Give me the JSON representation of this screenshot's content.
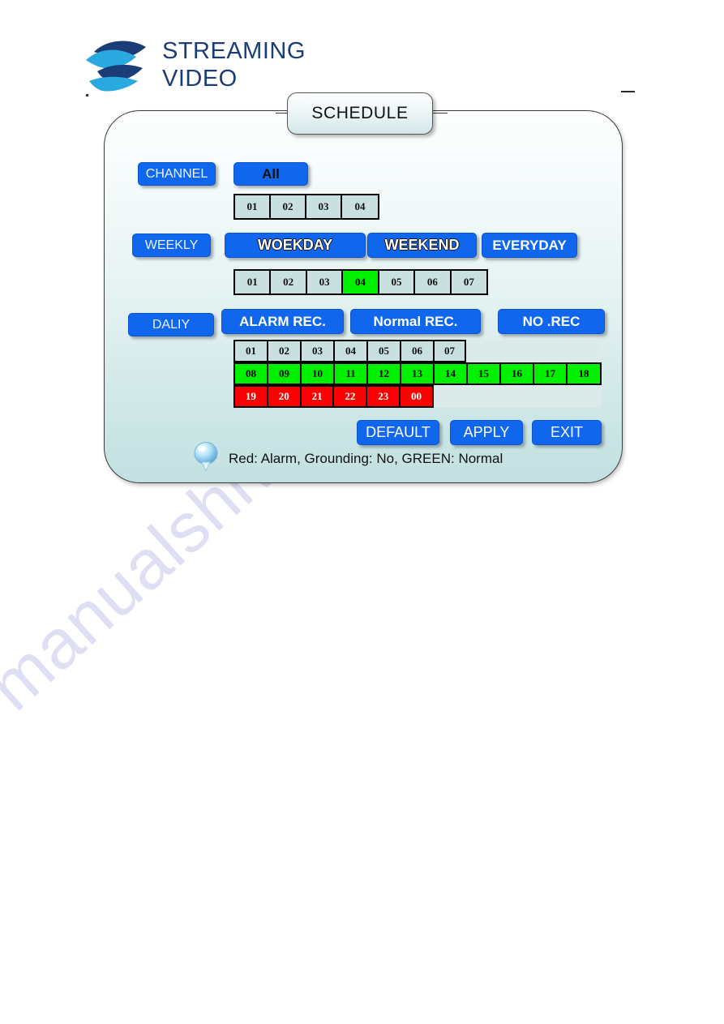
{
  "watermark": {
    "text": "manualshive.com"
  },
  "logo": {
    "line1": "STREAMING",
    "line2": "VIDEO",
    "mark": "wave-logo-icon"
  },
  "panel": {
    "title": "SCHEDULE"
  },
  "channel": {
    "label": "CHANNEL",
    "all_label": "All",
    "cells": [
      "01",
      "02",
      "03",
      "04"
    ]
  },
  "weekly": {
    "label": "WEEKLY",
    "buttons": [
      "WOEKDAY",
      "WEEKEND",
      "EVERYDAY"
    ],
    "cells": [
      "01",
      "02",
      "03",
      "04",
      "05",
      "06",
      "07"
    ],
    "selected": "04"
  },
  "daily": {
    "label": "DALIY",
    "buttons": [
      "ALARM REC.",
      "Normal REC.",
      "NO .REC"
    ],
    "rows": [
      {
        "cells": [
          "01",
          "02",
          "03",
          "04",
          "05",
          "06",
          "07"
        ],
        "state": "none"
      },
      {
        "cells": [
          "08",
          "09",
          "10",
          "11",
          "12",
          "13",
          "14",
          "15",
          "16",
          "17",
          "18"
        ],
        "state": "green"
      },
      {
        "cells": [
          "19",
          "20",
          "21",
          "22",
          "23",
          "00"
        ],
        "state": "red"
      }
    ]
  },
  "actions": {
    "default_label": "DEFAULT",
    "apply_label": "APPLY",
    "exit_label": "EXIT"
  },
  "footer": {
    "note": "Red: Alarm, Grounding: No, GREEN: Normal",
    "icon": "bulb-icon"
  },
  "colors": {
    "button_blue": "#1166ee",
    "cell_idle": "#c8e0e0",
    "cell_green": "#00f000",
    "cell_red": "#fa0000",
    "logo_navy": "#1b3c77",
    "logo_cyan": "#2aa8e0"
  }
}
